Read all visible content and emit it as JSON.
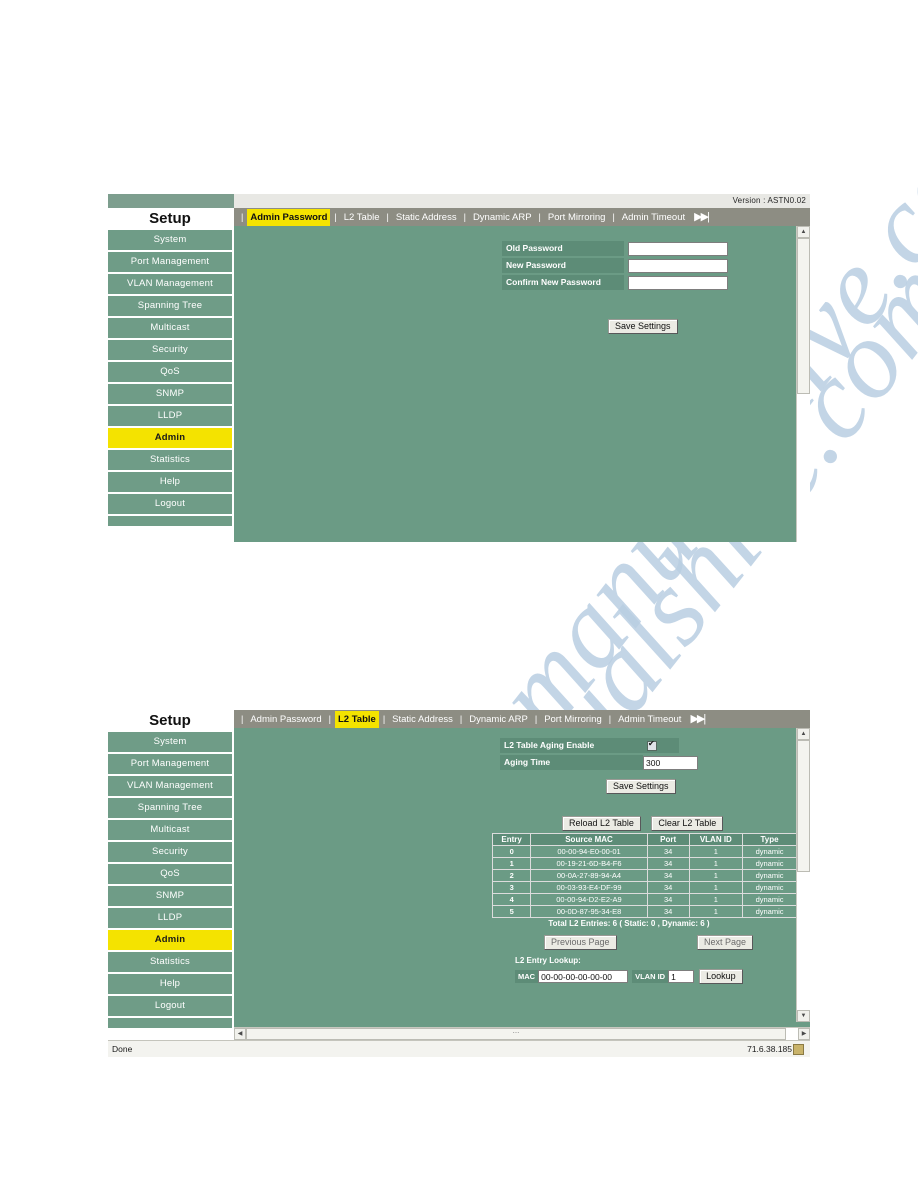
{
  "version_label": "Version :  ASTN0.02",
  "sidebar": {
    "title": "Setup",
    "items": [
      {
        "label": "System",
        "active": false
      },
      {
        "label": "Port Management",
        "active": false
      },
      {
        "label": "VLAN Management",
        "active": false
      },
      {
        "label": "Spanning Tree",
        "active": false
      },
      {
        "label": "Multicast",
        "active": false
      },
      {
        "label": "Security",
        "active": false
      },
      {
        "label": "QoS",
        "active": false
      },
      {
        "label": "SNMP",
        "active": false
      },
      {
        "label": "LLDP",
        "active": false
      },
      {
        "label": "Admin",
        "active": true
      },
      {
        "label": "Statistics",
        "active": false
      },
      {
        "label": "Help",
        "active": false
      },
      {
        "label": "Logout",
        "active": false
      }
    ]
  },
  "tabs": [
    {
      "label": "Admin Password"
    },
    {
      "label": "L2 Table"
    },
    {
      "label": "Static Address"
    },
    {
      "label": "Dynamic ARP"
    },
    {
      "label": "Port Mirroring"
    },
    {
      "label": "Admin Timeout"
    }
  ],
  "tab_overflow_icon": "fast-forward-icon",
  "panel1": {
    "active_tab": "Admin Password",
    "fields": [
      {
        "label": "Old Password",
        "value": "",
        "type": "password"
      },
      {
        "label": "New Password",
        "value": "",
        "type": "password"
      },
      {
        "label": "Confirm New Password",
        "value": "",
        "type": "password"
      }
    ],
    "save_button": "Save Settings"
  },
  "panel2": {
    "active_tab": "L2 Table",
    "aging_enable_label": "L2 Table Aging Enable",
    "aging_enable_checked": true,
    "aging_time_label": "Aging Time",
    "aging_time_value": "300",
    "save_button": "Save Settings",
    "reload_button": "Reload L2 Table",
    "clear_button": "Clear L2 Table",
    "table": {
      "headers": [
        "Entry",
        "Source MAC",
        "Port",
        "VLAN ID",
        "Type"
      ],
      "rows": [
        [
          "0",
          "00-00-94-E0-00-01",
          "34",
          "1",
          "dynamic"
        ],
        [
          "1",
          "00-19-21-6D-B4-F6",
          "34",
          "1",
          "dynamic"
        ],
        [
          "2",
          "00-0A-27-89-94-A4",
          "34",
          "1",
          "dynamic"
        ],
        [
          "3",
          "00-03-93-E4-DF-99",
          "34",
          "1",
          "dynamic"
        ],
        [
          "4",
          "00-00-94-D2-E2-A9",
          "34",
          "1",
          "dynamic"
        ],
        [
          "5",
          "00-0D-87-95-34-E8",
          "34",
          "1",
          "dynamic"
        ]
      ]
    },
    "totals_text": "Total L2 Entries: 6  ( Static: 0  , Dynamic: 6 )",
    "previous_page_button": "Previous Page",
    "next_page_button": "Next Page",
    "lookup_title": "L2 Entry Lookup:",
    "lookup_mac_label": "MAC",
    "lookup_mac_value": "00-00-00-00-00-00",
    "lookup_vlan_label": "VLAN ID",
    "lookup_vlan_value": "1",
    "lookup_button": "Lookup"
  },
  "statusbar": {
    "status": "Done",
    "ip": "71.6.38.185",
    "lock_icon": "lock-icon"
  },
  "watermark": {
    "line1": "manualshive.com",
    "line2": "manualshive.com"
  },
  "colors": {
    "panel_green": "#6b9b85",
    "sidebar_green": "#6f9c87",
    "label_green": "#5d8c77",
    "tabbar_gray": "#8d8d83",
    "highlight_yellow": "#f4e300"
  }
}
